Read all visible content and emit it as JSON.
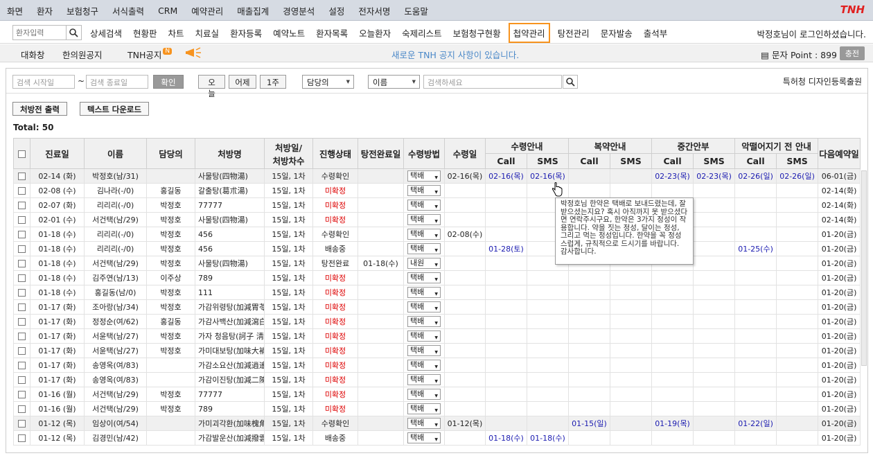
{
  "topmenu": [
    "화면",
    "환자",
    "보험청구",
    "서식출력",
    "CRM",
    "예약관리",
    "매출집계",
    "경영분석",
    "설정",
    "전자서명",
    "도움말"
  ],
  "brand": "TNH",
  "nav": {
    "search_placeholder": "환자입력",
    "items": [
      "상세검색",
      "현황판",
      "차트",
      "치료실",
      "환자등록",
      "예약노트",
      "환자목록",
      "오늘환자",
      "숙제리스트",
      "보험청구현황",
      "첩약관리",
      "탕전관리",
      "문자발송",
      "출석부"
    ],
    "active_index": 10,
    "login_text": "박정호님이 로그인하셨습니다."
  },
  "subbar": {
    "chat": "대화창",
    "notice_board": "한의원공지",
    "tnh_notice": "TNH공지",
    "badge": "N",
    "notice_text": "새로운 TNH 공지 사항이 있습니다.",
    "point_label": "문자 Point : 899",
    "charge": "충전"
  },
  "filter": {
    "start_placeholder": "검색 시작일",
    "tilde": "~",
    "end_placeholder": "검색 종료일",
    "confirm": "확인",
    "today": "오늘",
    "yesterday": "어제",
    "week": "1주",
    "doctor_select": "담당의",
    "field_select": "이름",
    "keyword_placeholder": "검색하세요",
    "patent": "특허청 디자인등록출원"
  },
  "actions": {
    "print": "처방전 출력",
    "download": "텍스트 다운로드"
  },
  "total": "Total: 50",
  "table": {
    "headers": {
      "date": "진료일",
      "name": "이름",
      "doctor": "담당의",
      "rx": "처방명",
      "rxday_line1": "처방일/",
      "rxday_line2": "처방차수",
      "status": "진행상태",
      "done": "탕전완료일",
      "method": "수령방법",
      "recv": "수령일",
      "g1": "수령안내",
      "g2": "복약안내",
      "g3": "중간안부",
      "g4": "악떨어지기 전 안내",
      "next": "다음예약일",
      "call": "Call",
      "sms": "SMS"
    },
    "rows": [
      {
        "date": "02-14 (화)",
        "name": "박정호(남/31)",
        "doc": "",
        "rx": "사물탕(四物湯)",
        "rd": "15일, 1차",
        "st": "수령확인",
        "stc": "",
        "done": "",
        "m": "택배",
        "recv": "02-16(목)",
        "c": [
          "02-16(목)",
          "02-16(목)",
          "",
          "",
          "02-23(목)",
          "02-23(목)",
          "02-26(일)",
          "02-26(일)"
        ],
        "next": "06-01(금)",
        "hl": true
      },
      {
        "date": "02-08 (수)",
        "name": "김나라(-/0)",
        "doc": "홍길동",
        "rx": "갈출탕(葛朮湯)",
        "rd": "15일, 1차",
        "st": "미확정",
        "stc": "red",
        "done": "",
        "m": "택배",
        "recv": "",
        "c": [
          "",
          "",
          "",
          "",
          "",
          "",
          "",
          ""
        ],
        "next": "02-14(화)"
      },
      {
        "date": "02-07 (화)",
        "name": "리리리(-/0)",
        "doc": "박정호",
        "rx": "77777",
        "rd": "15일, 1차",
        "st": "미확정",
        "stc": "red",
        "done": "",
        "m": "택배",
        "recv": "",
        "c": [
          "",
          "",
          "",
          "",
          "",
          "",
          "",
          ""
        ],
        "next": "02-14(화)"
      },
      {
        "date": "02-01 (수)",
        "name": "서건택(남/29)",
        "doc": "박정호",
        "rx": "사물탕(四物湯)",
        "rd": "15일, 1차",
        "st": "미확정",
        "stc": "red",
        "done": "",
        "m": "택배",
        "recv": "",
        "c": [
          "",
          "",
          "",
          "",
          "",
          "",
          "",
          ""
        ],
        "next": "02-14(화)"
      },
      {
        "date": "01-18 (수)",
        "name": "리리리(-/0)",
        "doc": "박정호",
        "rx": "456",
        "rd": "15일, 1차",
        "st": "수령확인",
        "stc": "",
        "done": "",
        "m": "택배",
        "recv": "02-08(수)",
        "c": [
          "",
          "",
          "",
          "",
          "",
          "",
          "",
          ""
        ],
        "next": "01-20(금)"
      },
      {
        "date": "01-18 (수)",
        "name": "리리리(-/0)",
        "doc": "박정호",
        "rx": "456",
        "rd": "15일, 1차",
        "st": "배송중",
        "stc": "",
        "done": "",
        "m": "택배",
        "recv": "",
        "c": [
          "01-28(토)",
          "",
          "",
          "",
          "",
          "",
          "01-25(수)",
          ""
        ],
        "next": "01-20(금)"
      },
      {
        "date": "01-18 (수)",
        "name": "서건택(남/29)",
        "doc": "박정호",
        "rx": "사물탕(四物湯)",
        "rd": "15일, 1차",
        "st": "탕전완료",
        "stc": "",
        "done": "01-18(수)",
        "m": "내원",
        "recv": "",
        "c": [
          "",
          "",
          "",
          "",
          "",
          "",
          "",
          ""
        ],
        "next": "01-20(금)"
      },
      {
        "date": "01-18 (수)",
        "name": "김주연(남/13)",
        "doc": "이주상",
        "rx": "789",
        "rd": "15일, 1차",
        "st": "미확정",
        "stc": "red",
        "done": "",
        "m": "택배",
        "recv": "",
        "c": [
          "",
          "",
          "",
          "",
          "",
          "",
          "",
          ""
        ],
        "next": "01-20(금)"
      },
      {
        "date": "01-18 (수)",
        "name": "홍길동(남/0)",
        "doc": "박정호",
        "rx": "111",
        "rd": "15일, 1차",
        "st": "미확정",
        "stc": "red",
        "done": "",
        "m": "택배",
        "recv": "",
        "c": [
          "",
          "",
          "",
          "",
          "",
          "",
          "",
          ""
        ],
        "next": "01-20(금)"
      },
      {
        "date": "01-17 (화)",
        "name": "조아랑(남/34)",
        "doc": "박정호",
        "rx": "가감위령탕(加減胃苓湯)",
        "rd": "15일, 1차",
        "st": "미확정",
        "stc": "red",
        "done": "",
        "m": "택배",
        "recv": "",
        "c": [
          "",
          "",
          "",
          "",
          "",
          "",
          "",
          ""
        ],
        "next": "01-20(금)"
      },
      {
        "date": "01-17 (화)",
        "name": "정정순(여/62)",
        "doc": "홍길동",
        "rx": "가감사백산(加減瀉白散)",
        "rd": "15일, 1차",
        "st": "미확정",
        "stc": "red",
        "done": "",
        "m": "택배",
        "recv": "",
        "c": [
          "",
          "",
          "",
          "",
          "",
          "",
          "",
          ""
        ],
        "next": "01-20(금)"
      },
      {
        "date": "01-17 (화)",
        "name": "서윤택(남/27)",
        "doc": "박정호",
        "rx": "가자 청음탕(訶子 淸音湯)",
        "rd": "15일, 1차",
        "st": "미확정",
        "stc": "red",
        "done": "",
        "m": "택배",
        "recv": "",
        "c": [
          "",
          "",
          "",
          "",
          "",
          "",
          "",
          ""
        ],
        "next": "01-20(금)"
      },
      {
        "date": "01-17 (화)",
        "name": "서윤택(남/27)",
        "doc": "박정호",
        "rx": "가미대보탕(加味大補湯)",
        "rd": "15일, 1차",
        "st": "미확정",
        "stc": "red",
        "done": "",
        "m": "택배",
        "recv": "",
        "c": [
          "",
          "",
          "",
          "",
          "",
          "",
          "",
          ""
        ],
        "next": "01-20(금)"
      },
      {
        "date": "01-17 (화)",
        "name": "송영옥(여/83)",
        "doc": "",
        "rx": "가감소요산(加減逍遙散)",
        "rd": "15일, 1차",
        "st": "미확정",
        "stc": "red",
        "done": "",
        "m": "택배",
        "recv": "",
        "c": [
          "",
          "",
          "",
          "",
          "",
          "",
          "",
          ""
        ],
        "next": "01-20(금)"
      },
      {
        "date": "01-17 (화)",
        "name": "송영옥(여/83)",
        "doc": "",
        "rx": "가감이진탕(加減二陳湯)",
        "rd": "15일, 1차",
        "st": "미확정",
        "stc": "red",
        "done": "",
        "m": "택배",
        "recv": "",
        "c": [
          "",
          "",
          "",
          "",
          "",
          "",
          "",
          ""
        ],
        "next": "01-20(금)"
      },
      {
        "date": "01-16 (월)",
        "name": "서건택(남/29)",
        "doc": "박정호",
        "rx": "77777",
        "rd": "15일, 1차",
        "st": "미확정",
        "stc": "red",
        "done": "",
        "m": "택배",
        "recv": "",
        "c": [
          "",
          "",
          "",
          "",
          "",
          "",
          "",
          ""
        ],
        "next": "01-20(금)"
      },
      {
        "date": "01-16 (월)",
        "name": "서건택(남/29)",
        "doc": "박정호",
        "rx": "789",
        "rd": "15일, 1차",
        "st": "미확정",
        "stc": "red",
        "done": "",
        "m": "택배",
        "recv": "",
        "c": [
          "",
          "",
          "",
          "",
          "",
          "",
          "",
          ""
        ],
        "next": "01-20(금)"
      },
      {
        "date": "01-12 (목)",
        "name": "임상이(여/54)",
        "doc": "",
        "rx": "가미괴각환(加味槐角丸)",
        "rd": "15일, 1차",
        "st": "수령확인",
        "stc": "",
        "done": "",
        "m": "택배",
        "recv": "01-12(목)",
        "c": [
          "",
          "",
          "01-15(일)",
          "",
          "01-19(목)",
          "",
          "01-22(일)",
          ""
        ],
        "next": "01-20(금)",
        "hl": true
      },
      {
        "date": "01-12 (목)",
        "name": "김경민(남/42)",
        "doc": "",
        "rx": "가감발운산(加減撥雲散)",
        "rd": "15일, 1차",
        "st": "배송중",
        "stc": "",
        "done": "",
        "m": "택배",
        "recv": "",
        "c": [
          "01-18(수)",
          "01-18(수)",
          "",
          "",
          "",
          "",
          "",
          ""
        ],
        "next": "01-20(금)"
      }
    ]
  },
  "tooltip": "박정호님 한약은 택배로 보내드렸는데, 잘 받으셨는지요? 혹시 아직까지 못 받으셨다면 연락주시구요, 한약은 3가지 정성이 작용합니다. 약을 짓는 정성, 달이는 정성, 그리고 먹는 정성입니다. 한약을 꼭 정성스럽게, 규칙적으로 드시기를 바랍니다. 감사합니다.",
  "colors": {
    "accent": "#f7931e",
    "brand": "#e02020",
    "notice": "#4a88c8",
    "pending": "#d00000",
    "date_link": "#1a1ab0"
  }
}
